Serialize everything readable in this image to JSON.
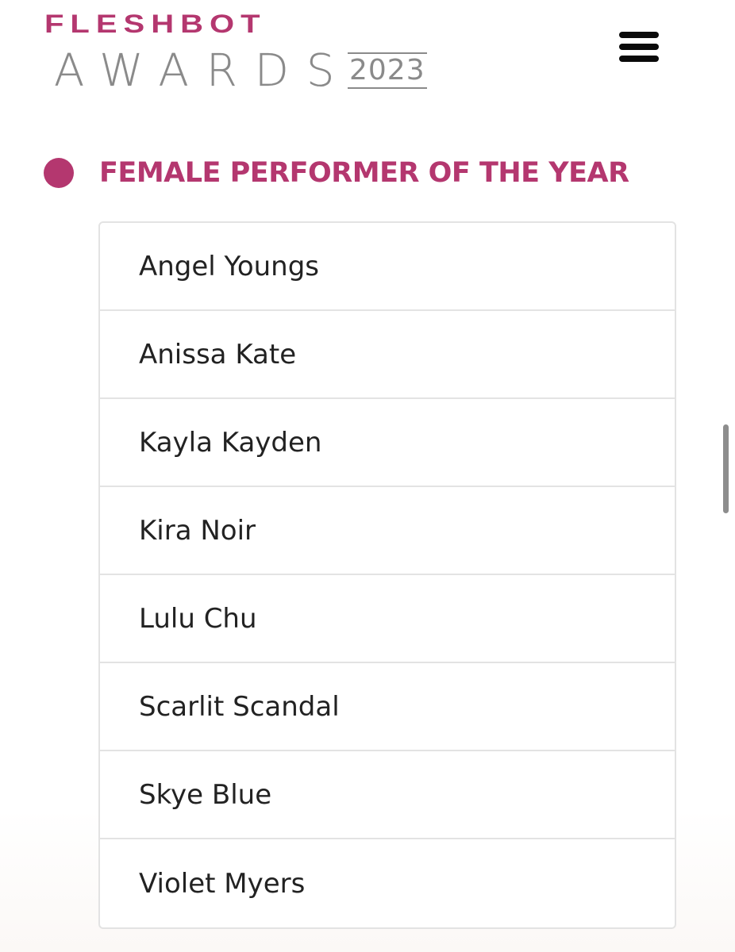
{
  "logo": {
    "line1": "FLESHBOT",
    "line2": "AWARDS",
    "year": "2023"
  },
  "menu": {
    "icon": "hamburger-menu-icon"
  },
  "section": {
    "heading": "FEMALE PERFORMER OF THE YEAR",
    "bullet_color": "#b4376f"
  },
  "nominees": [
    "Angel Youngs",
    "Anissa Kate",
    "Kayla Kayden",
    "Kira Noir",
    "Lulu Chu",
    "Scarlit Scandal",
    "Skye Blue",
    "Violet Myers"
  ],
  "colors": {
    "accent": "#b4376f",
    "logo_gray": "#8a8a8a",
    "text": "#222222",
    "border": "#e3e3e3"
  }
}
